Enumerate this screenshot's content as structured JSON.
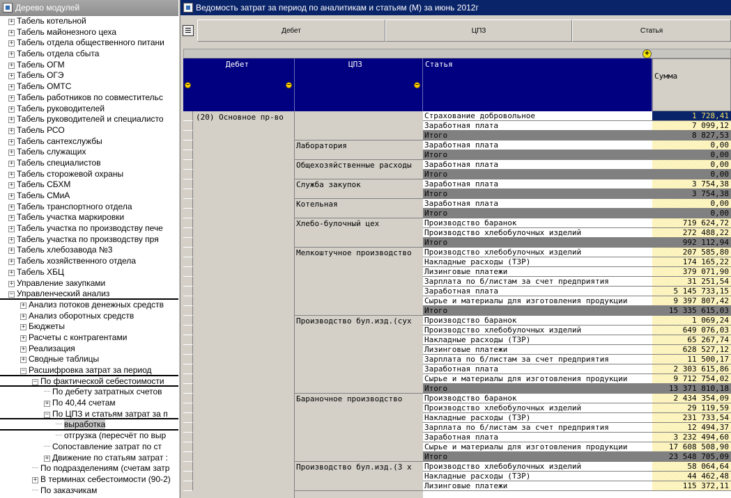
{
  "left_panel": {
    "title": "Дерево модулей",
    "items": [
      {
        "label": "Табель котельной",
        "level": 0,
        "toggle": "+"
      },
      {
        "label": "Табель майонезного цеха",
        "level": 0,
        "toggle": "+"
      },
      {
        "label": "Табель отдела общественного питани",
        "level": 0,
        "toggle": "+"
      },
      {
        "label": "Табель отдела сбыта",
        "level": 0,
        "toggle": "+"
      },
      {
        "label": "Табель ОГМ",
        "level": 0,
        "toggle": "+"
      },
      {
        "label": "Табель ОГЭ",
        "level": 0,
        "toggle": "+"
      },
      {
        "label": "Табель ОМТС",
        "level": 0,
        "toggle": "+"
      },
      {
        "label": "Табель работников по совместительс",
        "level": 0,
        "toggle": "+"
      },
      {
        "label": "Табель руководителей",
        "level": 0,
        "toggle": "+"
      },
      {
        "label": "Табель руководителей и специалисто",
        "level": 0,
        "toggle": "+"
      },
      {
        "label": "Табель РСО",
        "level": 0,
        "toggle": "+"
      },
      {
        "label": "Табель сантехслужбы",
        "level": 0,
        "toggle": "+"
      },
      {
        "label": "Табель служащих",
        "level": 0,
        "toggle": "+"
      },
      {
        "label": "Табель специалистов",
        "level": 0,
        "toggle": "+"
      },
      {
        "label": "Табель сторожевой охраны",
        "level": 0,
        "toggle": "+"
      },
      {
        "label": "Табель СБХМ",
        "level": 0,
        "toggle": "+"
      },
      {
        "label": "Табель СМиА",
        "level": 0,
        "toggle": "+"
      },
      {
        "label": "Табель транспортного отдела",
        "level": 0,
        "toggle": "+"
      },
      {
        "label": "Табель участка маркировки",
        "level": 0,
        "toggle": "+"
      },
      {
        "label": "Табель участка по производству пече",
        "level": 0,
        "toggle": "+"
      },
      {
        "label": "Табель участка по производству пря",
        "level": 0,
        "toggle": "+"
      },
      {
        "label": "Табель хлебозавода №3",
        "level": 0,
        "toggle": "+"
      },
      {
        "label": "Табель хозяйственного отдела",
        "level": 0,
        "toggle": "+"
      },
      {
        "label": "Табель ХБЦ",
        "level": 0,
        "toggle": "+"
      },
      {
        "label": "Управление закупками",
        "level": 0,
        "toggle": "+"
      },
      {
        "label": "Управленческий анализ",
        "level": 0,
        "toggle": "-",
        "underline": true
      },
      {
        "label": "Анализ потоков денежных средств",
        "level": 1,
        "toggle": "+"
      },
      {
        "label": "Анализ оборотных средств",
        "level": 1,
        "toggle": "+"
      },
      {
        "label": "Бюджеты",
        "level": 1,
        "toggle": "+"
      },
      {
        "label": "Расчеты с контрагентами",
        "level": 1,
        "toggle": "+"
      },
      {
        "label": "Реализация",
        "level": 1,
        "toggle": "+"
      },
      {
        "label": "Сводные таблицы",
        "level": 1,
        "toggle": "+"
      },
      {
        "label": "Расшифровка затрат за период",
        "level": 1,
        "toggle": "-",
        "underline": true
      },
      {
        "label": "По фактической себестоимости",
        "level": 2,
        "toggle": "-",
        "underline": true
      },
      {
        "label": "По дебету затратных счетов",
        "level": 3,
        "toggle": ""
      },
      {
        "label": "По 40,44 счетам",
        "level": 3,
        "toggle": "+"
      },
      {
        "label": "По ЦПЗ и статьям затрат за п",
        "level": 3,
        "toggle": "-",
        "underline": true
      },
      {
        "label": "выработка",
        "level": 4,
        "toggle": "",
        "underline": true,
        "selected": true
      },
      {
        "label": "отгрузка (пересчёт по выр",
        "level": 4,
        "toggle": ""
      },
      {
        "label": "Сопоставление затрат по ст",
        "level": 3,
        "toggle": ""
      },
      {
        "label": "Движение по статьям затрат :",
        "level": 3,
        "toggle": "+"
      },
      {
        "label": "По подразделениям (счетам затр",
        "level": 2,
        "toggle": ""
      },
      {
        "label": "В терминах себестоимости (90-2)",
        "level": 2,
        "toggle": "+"
      },
      {
        "label": "По заказчикам",
        "level": 2,
        "toggle": ""
      }
    ]
  },
  "report": {
    "title": "Ведомость затрат за период по аналитикам и статьям (М)  за июнь 2012г",
    "toolbar": {
      "debet": "Дебет",
      "cpz": "ЦПЗ",
      "article": "Статья"
    },
    "headers": {
      "debet": "Дебет",
      "cpz": "ЦПЗ",
      "article": "Статья",
      "sum": "Сумма"
    },
    "debet_value": "(20) Основное пр-во",
    "groups": [
      {
        "cpz": "",
        "rows": [
          {
            "article": "Страхование добровольное",
            "sum": "1 728,41",
            "selected": true
          },
          {
            "article": "Заработная плата",
            "sum": "7 099,12"
          },
          {
            "article": "Итого",
            "sum": "8 827,53",
            "total": true
          }
        ]
      },
      {
        "cpz": "Лаборатория",
        "rows": [
          {
            "article": "Заработная плата",
            "sum": "0,00"
          },
          {
            "article": "Итого",
            "sum": "0,00",
            "total": true
          }
        ]
      },
      {
        "cpz": "Общехозяйственные расходы",
        "rows": [
          {
            "article": "Заработная плата",
            "sum": "0,00"
          },
          {
            "article": "Итого",
            "sum": "0,00",
            "total": true
          }
        ]
      },
      {
        "cpz": "Служба закупок",
        "rows": [
          {
            "article": "Заработная плата",
            "sum": "3 754,38"
          },
          {
            "article": "Итого",
            "sum": "3 754,38",
            "total": true
          }
        ]
      },
      {
        "cpz": "Котельная",
        "rows": [
          {
            "article": "Заработная плата",
            "sum": "0,00"
          },
          {
            "article": "Итого",
            "sum": "0,00",
            "total": true
          }
        ]
      },
      {
        "cpz": "Хлебо-булочный цех",
        "rows": [
          {
            "article": "Производство баранок",
            "sum": "719 624,72"
          },
          {
            "article": "Производство хлебобулочных изделий",
            "sum": "272 488,22"
          },
          {
            "article": "Итого",
            "sum": "992 112,94",
            "total": true
          }
        ]
      },
      {
        "cpz": "Мелкоштучное производство",
        "rows": [
          {
            "article": "Производство хлебобулочных изделий",
            "sum": "207 585,80"
          },
          {
            "article": "Накладные расходы (ТЗР)",
            "sum": "174 165,22"
          },
          {
            "article": "Лизинговые платежи",
            "sum": "379 071,90"
          },
          {
            "article": "Зарплата по б/листам за счет предприятия",
            "sum": "31 251,54"
          },
          {
            "article": "Заработная плата",
            "sum": "5 145 733,15"
          },
          {
            "article": "Сырье и материалы для изготовления продукции",
            "sum": "9 397 807,42"
          },
          {
            "article": "Итого",
            "sum": "15 335 615,03",
            "total": true
          }
        ]
      },
      {
        "cpz": "Производство бул.изд.(сух",
        "rows": [
          {
            "article": "Производство баранок",
            "sum": "1 069,24"
          },
          {
            "article": "Производство хлебобулочных изделий",
            "sum": "649 076,03"
          },
          {
            "article": "Накладные расходы (ТЗР)",
            "sum": "65 267,74"
          },
          {
            "article": "Лизинговые платежи",
            "sum": "628 527,12"
          },
          {
            "article": "Зарплата по б/листам за счет предприятия",
            "sum": "11 500,17"
          },
          {
            "article": "Заработная плата",
            "sum": "2 303 615,86"
          },
          {
            "article": "Сырье и материалы для изготовления продукции",
            "sum": "9 712 754,02"
          },
          {
            "article": "Итого",
            "sum": "13 371 810,18",
            "total": true
          }
        ]
      },
      {
        "cpz": "Бараночное производство",
        "rows": [
          {
            "article": "Производство баранок",
            "sum": "2 434 354,09"
          },
          {
            "article": "Производство хлебобулочных изделий",
            "sum": "29 119,59"
          },
          {
            "article": "Накладные расходы (ТЗР)",
            "sum": "231 733,54"
          },
          {
            "article": "Зарплата по б/листам за счет предприятия",
            "sum": "12 494,37"
          },
          {
            "article": "Заработная плата",
            "sum": "3 232 494,60"
          },
          {
            "article": "Сырье и материалы для изготовления продукции",
            "sum": "17 608 508,90"
          },
          {
            "article": "Итого",
            "sum": "23 548 705,09",
            "total": true
          }
        ]
      },
      {
        "cpz": "Производство бул.изд.(3 х",
        "rows": [
          {
            "article": "Производство хлебобулочных изделий",
            "sum": "58 064,64"
          },
          {
            "article": "Накладные расходы (ТЗР)",
            "sum": "44 462,48"
          },
          {
            "article": "Лизинговые платежи",
            "sum": "115 372,11"
          }
        ]
      }
    ]
  }
}
